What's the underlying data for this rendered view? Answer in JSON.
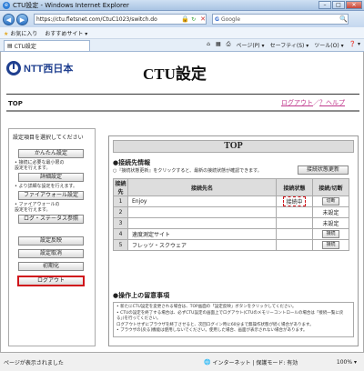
{
  "browser": {
    "window_title": "CTU設定 - Windows Internet Explorer",
    "url": "https://ctu.fletsnet.com/CtuC1023/switch.do",
    "search_placeholder": "Google",
    "favorites_label": "お気に入り",
    "suggested_sites_label": "おすすめサイト ▾",
    "tab_title": "CTU設定",
    "commands": [
      "ページ(P) ▾",
      "セーフティ(S) ▾",
      "ツール(O) ▾",
      "❓ ▾"
    ],
    "status_text": "ページが表示されました",
    "zone_text": "インターネット | 保護モード: 有効",
    "zoom_text": "100% ▾"
  },
  "page": {
    "logo_text": "NTT西日本",
    "heading": "CTU設定",
    "page_name": "TOP",
    "logout_link": "ログアウト",
    "help_link": "？ヘルプ",
    "sidebar_title": "設定項目を選択してください",
    "sidebar_buttons": {
      "simple_setup": "かんたん設定",
      "detailed_setup": "詳細設定",
      "firewall_setup": "ファイアウォール設定",
      "log_status": "ログ・ステータス参照",
      "apply": "設定反映",
      "cancel": "設定取消",
      "reset": "初期化",
      "logout": "ログアウト"
    },
    "sidebar_notes": {
      "simple": "• 接続に必要な最小限の\n設定を行えます。",
      "detailed": "• より詳細な設定を行えます。",
      "firewall": "• ファイアウォールの\n設定を行えます。"
    },
    "main_title": "TOP",
    "conn_section_title": "●接続先情報",
    "conn_section_sub": "○『接続状態更新』をクリックすると、最新の接続状態が確認できます。",
    "refresh_button": "接続状態更新",
    "table_headers": [
      "接続先",
      "接続先名",
      "接続状態",
      "接続/切断"
    ],
    "rows": [
      {
        "no": "1",
        "name": "Enjoy",
        "status": "接続中",
        "action": "切断"
      },
      {
        "no": "2",
        "name": "",
        "status": "",
        "action": "未設定"
      },
      {
        "no": "3",
        "name": "",
        "status": "",
        "action": "未設定"
      },
      {
        "no": "4",
        "name": "速度測定サイト",
        "status": "",
        "action": "接続"
      },
      {
        "no": "5",
        "name": "フレッツ・スクウェア",
        "status": "",
        "action": "接続"
      }
    ],
    "notes_title": "●操作上の留意事項",
    "notes_lines": [
      "• 新たにCTU設定を変更される場合は、TOP画面の「設定反映」ボタンをクリックしてください。",
      "• CTUの設定を終了する場合は、必ずCTU設定の画面上でログアウト(CTUのメモリーコントロールの場合は「接続一覧に戻る」)を行ってください。",
      "  ログアウトせずにブラウザを終了させると、次回ログイン時に60分まで無操作状態が続く場合があります。",
      "• ブラウザの[戻る]機能は使用しないでください。使用した場合、画面が表示されない場合があります。"
    ]
  }
}
